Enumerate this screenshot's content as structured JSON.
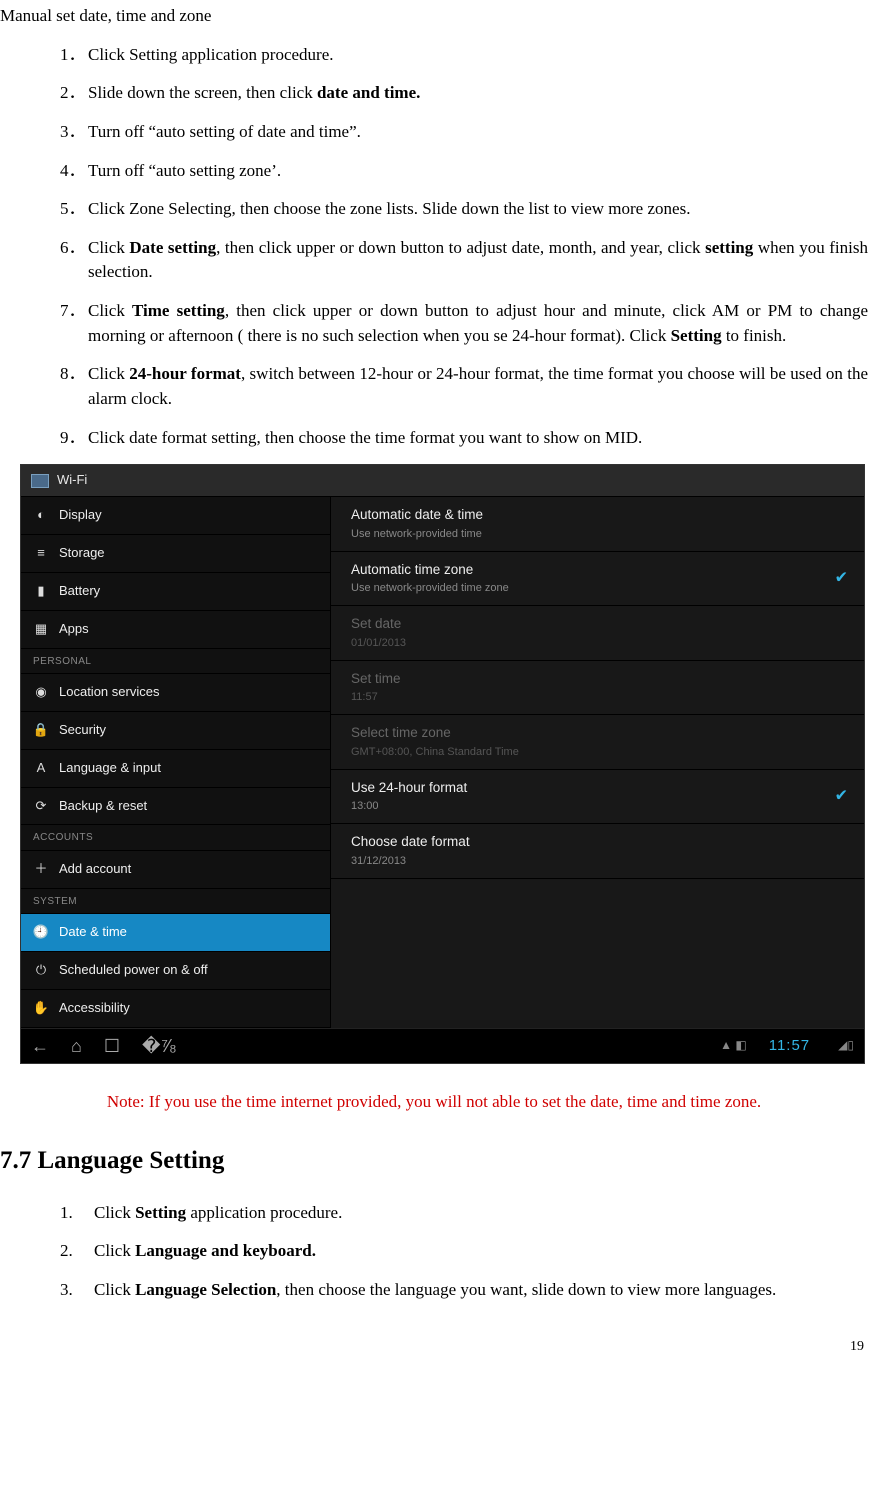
{
  "title": "Manual set date, time and zone",
  "steps": [
    {
      "n": "1．",
      "html": "Click Setting application procedure."
    },
    {
      "n": "2．",
      "html": "Slide down the screen, then click <b>date and time.</b>"
    },
    {
      "n": "3．",
      "html": "Turn off “auto setting of date and time”."
    },
    {
      "n": "4．",
      "html": "Turn off “auto setting zone’."
    },
    {
      "n": "5．",
      "html": "Click Zone Selecting, then choose the zone lists. Slide down the list to view more zones."
    },
    {
      "n": "6．",
      "html": "Click <b>Date setting</b>, then click upper or down button to adjust date, month, and year, click <b>setting</b> when you finish selection."
    },
    {
      "n": "7．",
      "html": "Click <b>Time setting</b>, then click upper or down button to adjust hour and minute, click AM or PM to change morning or afternoon ( there is no such selection when you se 24-hour format). Click <b>Setting</b> to finish."
    },
    {
      "n": "8．",
      "html": "Click <b>24-hour format</b>, switch between 12-hour or 24-hour format, the time format you choose will be used on the alarm clock."
    },
    {
      "n": "9．",
      "html": "Click date format setting, then choose the time format you want to show on MID."
    }
  ],
  "screenshot": {
    "top": "Wi-Fi",
    "sidebar": {
      "items_top": [
        {
          "icon": "◐",
          "label": "Display"
        },
        {
          "icon": "≡",
          "label": "Storage"
        },
        {
          "icon": "▮",
          "label": "Battery"
        },
        {
          "icon": "▦",
          "label": "Apps"
        }
      ],
      "hdr1": "PERSONAL",
      "items_personal": [
        {
          "icon": "◉",
          "label": "Location services"
        },
        {
          "icon": "🔒",
          "label": "Security"
        },
        {
          "icon": "A",
          "label": "Language & input"
        },
        {
          "icon": "⟳",
          "label": "Backup & reset"
        }
      ],
      "hdr2": "ACCOUNTS",
      "items_accounts": [
        {
          "icon": "＋",
          "label": "Add account"
        }
      ],
      "hdr3": "SYSTEM",
      "items_system": [
        {
          "icon": "🕘",
          "label": "Date & time",
          "selected": true
        },
        {
          "icon": "⏻",
          "label": "Scheduled power on & off"
        },
        {
          "icon": "✋",
          "label": "Accessibility"
        }
      ]
    },
    "main": [
      {
        "label": "Automatic date & time",
        "sub": "Use network-provided time",
        "disabled": false,
        "checked": false
      },
      {
        "label": "Automatic time zone",
        "sub": "Use network-provided time zone",
        "disabled": false,
        "checked": true
      },
      {
        "label": "Set date",
        "sub": "01/01/2013",
        "disabled": true
      },
      {
        "label": "Set time",
        "sub": "11:57",
        "disabled": true
      },
      {
        "label": "Select time zone",
        "sub": "GMT+08:00, China Standard Time",
        "disabled": true
      },
      {
        "label": "Use 24-hour format",
        "sub": "13:00",
        "disabled": false,
        "checked": true
      },
      {
        "label": "Choose date format",
        "sub": "31/12/2013",
        "disabled": false
      }
    ],
    "status_time": "11:57"
  },
  "note": "Note: If you use the time internet provided, you will not able to set the date, time and time zone.",
  "section_heading": "7.7 Language Setting",
  "lang_steps": [
    {
      "n": "1.",
      "html": "Click <b>Setting</b> application procedure."
    },
    {
      "n": "2.",
      "html": "Click <b>Language and keyboard.</b>"
    },
    {
      "n": "3.",
      "html": "Click <b>Language Selection</b>, then choose the language you want, slide down to view more languages."
    }
  ],
  "page_number": "19"
}
